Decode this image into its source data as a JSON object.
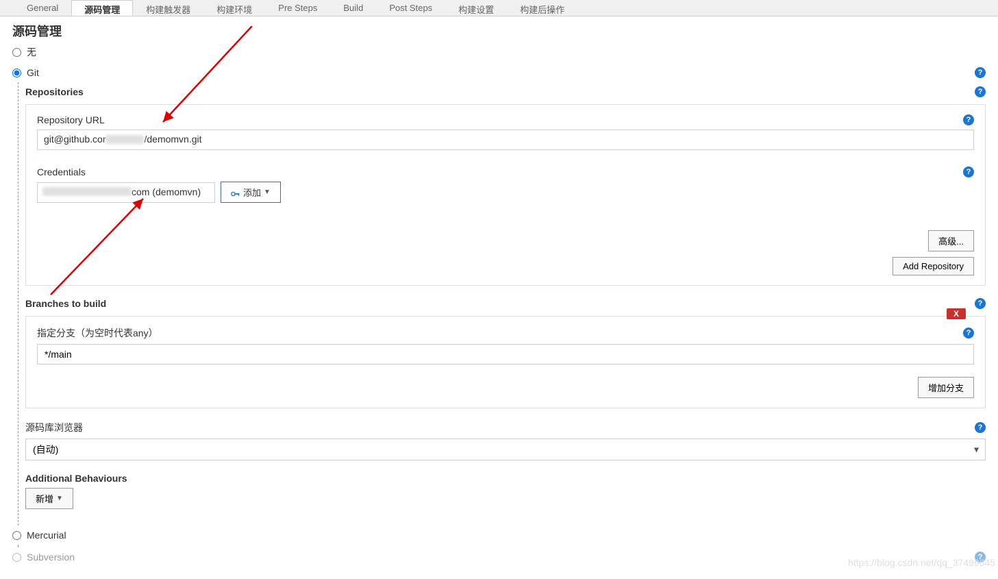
{
  "tabs": {
    "general": "General",
    "scm": "源码管理",
    "triggers": "构建触发器",
    "env": "构建环境",
    "presteps": "Pre Steps",
    "build": "Build",
    "poststeps": "Post Steps",
    "settings": "构建设置",
    "postbuild": "构建后操作"
  },
  "section_title": "源码管理",
  "scm": {
    "none_label": "无",
    "git_label": "Git",
    "mercurial_label": "Mercurial",
    "subversion_label": "Subversion"
  },
  "repos": {
    "header": "Repositories",
    "url_label": "Repository URL",
    "url_value_prefix": "git@github.cor",
    "url_value_suffix": "/demomvn.git",
    "cred_label": "Credentials",
    "cred_value_suffix": "com (demomvn)",
    "add_label": "添加",
    "advanced_label": "高级...",
    "add_repo_label": "Add Repository"
  },
  "branches": {
    "header": "Branches to build",
    "spec_label": "指定分支（为空时代表any）",
    "spec_value": "*/main",
    "delete_label": "X",
    "add_branch_label": "增加分支"
  },
  "browser": {
    "label": "源码库浏览器",
    "value": "(自动)"
  },
  "behaviours": {
    "label": "Additional Behaviours",
    "add_label": "新增"
  },
  "watermark": "https://blog.csdn.net/qq_37499645"
}
